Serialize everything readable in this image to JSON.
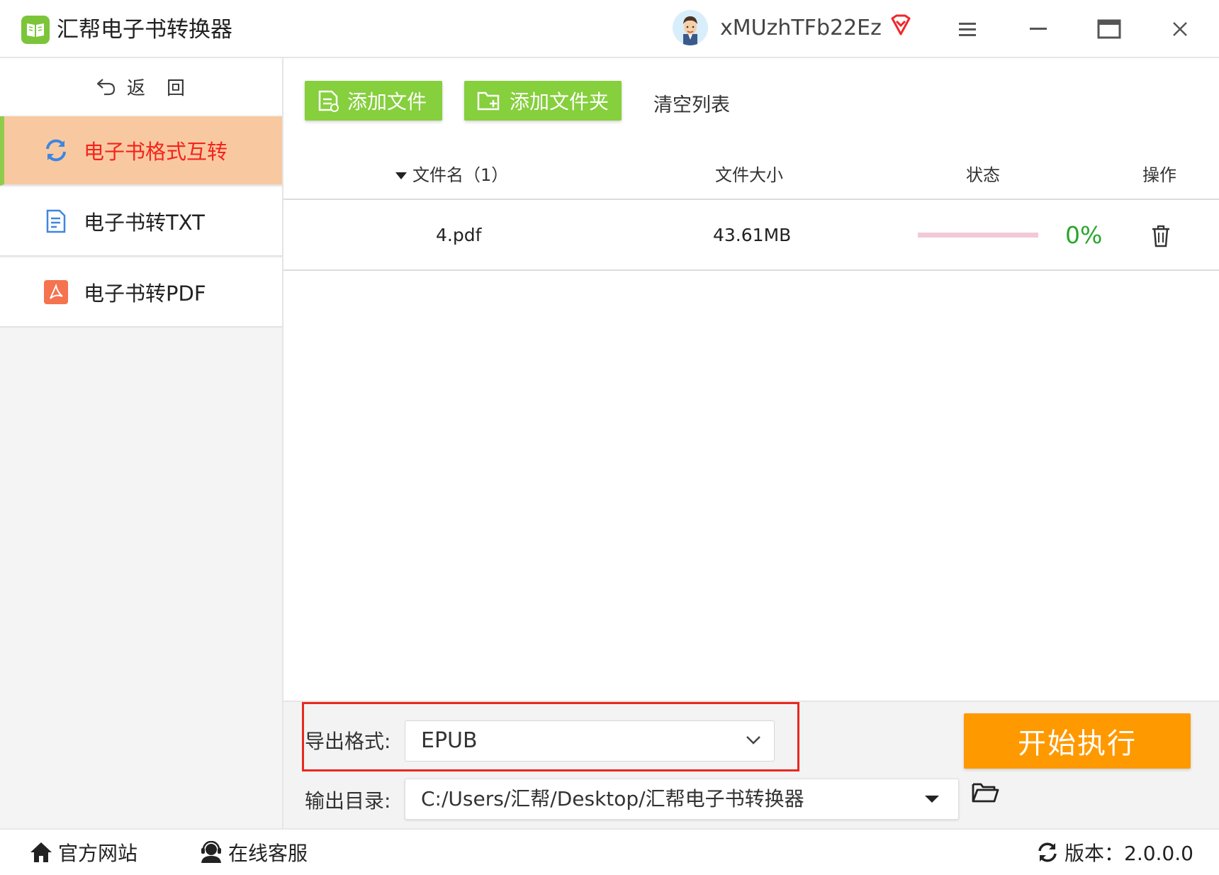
{
  "titlebar": {
    "app_title": "汇帮电子书转换器",
    "username": "xMUzhTFb22Ez",
    "icons": [
      "app-logo-icon",
      "avatar",
      "vip-diamond-icon",
      "menu-icon",
      "minimize-icon",
      "maximize-icon",
      "close-icon"
    ],
    "vip_color": "#f0262b"
  },
  "sidebar": {
    "back_label": "返　回",
    "items": [
      {
        "label": "电子书格式互转",
        "icon": "refresh-icon",
        "active": true
      },
      {
        "label": "电子书转TXT",
        "icon": "document-icon",
        "active": false
      },
      {
        "label": "电子书转PDF",
        "icon": "pdf-icon",
        "active": false
      }
    ],
    "active_bg": "#f8c9a1",
    "active_text_color": "#f5231b",
    "active_border": "#8fcc4b"
  },
  "toolbar": {
    "add_file_label": "添加文件",
    "add_folder_label": "添加文件夹",
    "clear_label": "清空列表",
    "button_color": "#86cf3d"
  },
  "table": {
    "columns": {
      "name": "文件名（1）",
      "size": "文件大小",
      "status": "状态",
      "action": "操作"
    },
    "rows": [
      {
        "name": "4.pdf",
        "size": "43.61MB",
        "progress": 0,
        "percent_text": "0%"
      }
    ]
  },
  "settings": {
    "format_label": "导出格式:",
    "format_value": "EPUB",
    "output_label": "输出目录:",
    "output_value": "C:/Users/汇帮/Desktop/汇帮电子书转换器",
    "start_label": "开始执行",
    "start_color": "#ff9900",
    "highlight_color": "#e8281f"
  },
  "footer": {
    "website_label": "官方网站",
    "support_label": "在线客服",
    "version_label": "版本：2.0.0.0"
  }
}
